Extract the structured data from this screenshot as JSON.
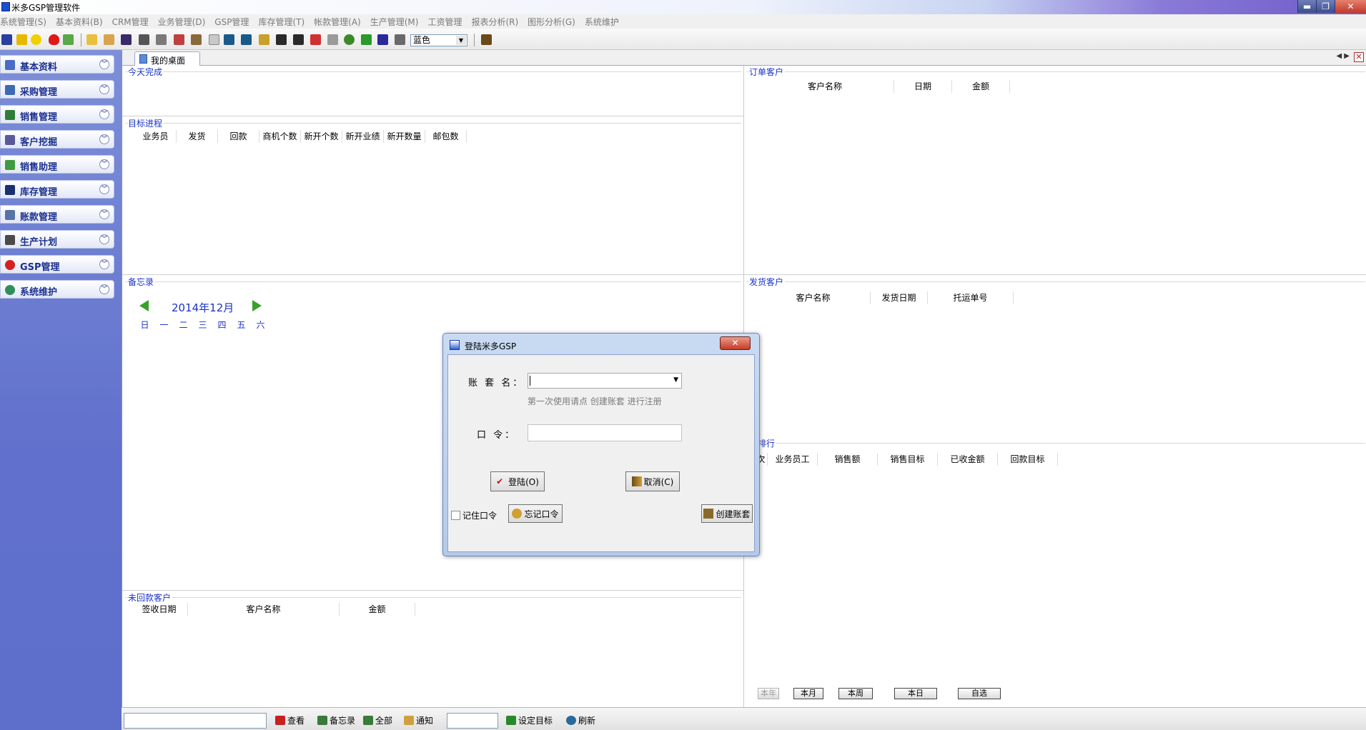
{
  "window": {
    "title": "米多GSP管理软件",
    "min": "▬",
    "max": "❐",
    "close": "✕"
  },
  "menu": [
    "系统管理(S)",
    "基本资料(B)",
    "CRM管理",
    "业务管理(D)",
    "GSP管理",
    "库存管理(T)",
    "帐款管理(A)",
    "生产管理(M)",
    "工资管理",
    "报表分析(R)",
    "图形分析(G)",
    "系统维护"
  ],
  "toolbar": {
    "color_select": "蓝色",
    "dropdown_arrow": "▼"
  },
  "sidebar": [
    {
      "label": "基本资料",
      "icon": "id-card-icon",
      "color": "#4a6cc2"
    },
    {
      "label": "采购管理",
      "icon": "purchase-icon",
      "color": "#3d6ab3"
    },
    {
      "label": "销售管理",
      "icon": "sales-icon",
      "color": "#2e7d3a"
    },
    {
      "label": "客户挖掘",
      "icon": "pickaxe-icon",
      "color": "#5a5a9a"
    },
    {
      "label": "销售助理",
      "icon": "calendar-icon",
      "color": "#3f9b3f"
    },
    {
      "label": "库存管理",
      "icon": "warehouse-icon",
      "color": "#1c2f6e"
    },
    {
      "label": "账款管理",
      "icon": "ledger-icon",
      "color": "#5873a8"
    },
    {
      "label": "生产计划",
      "icon": "factory-icon",
      "color": "#4a4a4a"
    },
    {
      "label": "GSP管理",
      "icon": "gsp-icon",
      "color": "#d32020"
    },
    {
      "label": "系统维护",
      "icon": "maintenance-icon",
      "color": "#2f8f5a"
    }
  ],
  "sidebar_chevron": "︾",
  "tabs": {
    "desktop": "我的桌面",
    "nav": "◀ ▶",
    "close": "✕"
  },
  "panels": {
    "today": {
      "title": "今天完成"
    },
    "goal": {
      "title": "目标进程",
      "headers": [
        "业务员",
        "发货",
        "回款",
        "商机个数",
        "新开个数",
        "新开业绩",
        "新开数量",
        "邮包数"
      ]
    },
    "memo": {
      "title": "备忘录",
      "month": "2014年12月",
      "weekdays": [
        "日",
        "一",
        "二",
        "三",
        "四",
        "五",
        "六"
      ]
    },
    "unpaid": {
      "title": "未回款客户",
      "headers": [
        "签收日期",
        "客户名称",
        "金额"
      ]
    },
    "orders": {
      "title": "订单客户",
      "headers": [
        "客户名称",
        "日期",
        "金额"
      ]
    },
    "shipping": {
      "title": "发货客户",
      "headers": [
        "客户名称",
        "发货日期",
        "托运单号"
      ]
    },
    "ranking": {
      "title": "绩排行",
      "headers": [
        "名次",
        "业务员工",
        "销售额",
        "销售目标",
        "已收金额",
        "回款目标"
      ],
      "buttons": [
        "本年",
        "本月",
        "本周",
        "本日",
        "自选"
      ]
    }
  },
  "bottombar": {
    "buttons": [
      "查看",
      "备忘录",
      "全部",
      "通知",
      "设定目标",
      "刷新"
    ]
  },
  "login": {
    "title": "登陆米多GSP",
    "account_label": "账 套 名：",
    "hint": "第一次使用请点 创建账套 进行注册",
    "password_label": "口 令：",
    "login_button": "登陆(O)",
    "cancel_button": "取消(C)",
    "remember": "记住口令",
    "forgot_button": "忘记口令",
    "create_button": "创建账套",
    "close": "✕"
  }
}
